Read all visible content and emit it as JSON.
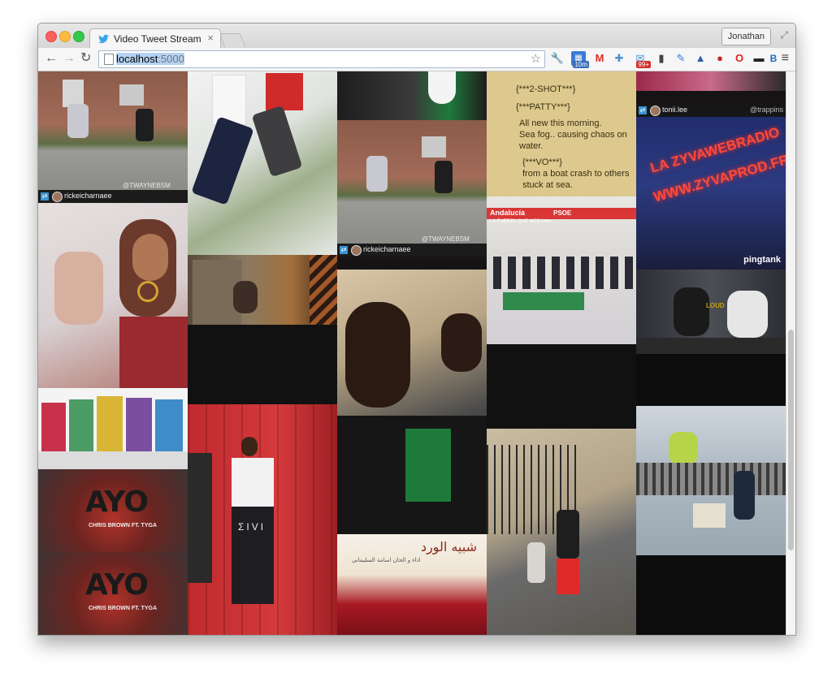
{
  "browser": {
    "tab_title": "Video Tweet Stream",
    "tab_close": "×",
    "profile_name": "Jonathan",
    "url_host": "localhost",
    "url_port": ":5000",
    "extensions": [
      {
        "icon": "wrench-icon",
        "badge": ""
      },
      {
        "icon": "calendar-icon",
        "badge": "10m"
      },
      {
        "icon": "gmail-icon",
        "badge": ""
      },
      {
        "icon": "puzzle-icon",
        "badge": ""
      },
      {
        "icon": "mail-icon",
        "badge": "99+"
      },
      {
        "icon": "lock-icon",
        "badge": ""
      },
      {
        "icon": "eyedropper-icon",
        "badge": ""
      },
      {
        "icon": "image-icon",
        "badge": ""
      },
      {
        "icon": "lastpass-icon",
        "badge": ""
      },
      {
        "icon": "opera-icon",
        "badge": ""
      },
      {
        "icon": "mask-icon",
        "badge": ""
      },
      {
        "icon": "b-icon",
        "badge": ""
      }
    ]
  },
  "tiles": {
    "t1": {
      "watermark": "@TWAYNEBSM",
      "username": "rickeicharnaee"
    },
    "t2": {
      "watermark": "@TWAYNEBSM",
      "username": "rickeicharnaee"
    },
    "note": {
      "lines": [
        "{***2-SHOT***}",
        "{***PATTY***}",
        "All new this morning.",
        "Sea fog.. causing chaos on",
        "water.",
        "{***VO***}",
        "from a boat crash to others",
        "stuck at sea."
      ]
    },
    "tonii": {
      "username": "tonii.lee",
      "handle": "@trappins"
    },
    "neon": {
      "line1": "LA ZYVAWEBRADIO",
      "line2": "WWW.ZYVAPROD.FR",
      "logo": "pingtank"
    },
    "andalucia": {
      "label": "Andalucía",
      "slogan": "LA FUERZA QUE NOS UNE",
      "party": "PSOE"
    },
    "ayo": {
      "title": "AYO",
      "sub": "CHRIS BROWN FT. TYGA"
    },
    "shirt": {
      "text": "ΣIVI"
    },
    "roses": {
      "title": "شبيه الورد",
      "subtitle": "اداء و الحان اسامة السليماني"
    },
    "sirius": {
      "mic": "LOUD"
    }
  }
}
